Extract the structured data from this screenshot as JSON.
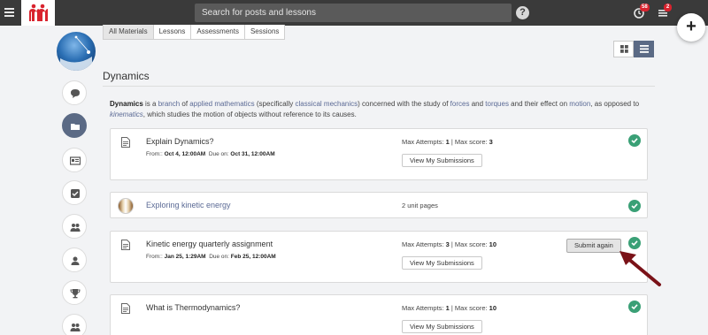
{
  "topbar": {
    "search_placeholder": "Search for posts and lessons",
    "help_label": "?",
    "notification_count": "58",
    "message_count": "2",
    "add_label": "+"
  },
  "tabs": [
    {
      "label": "All Materials",
      "active": true
    },
    {
      "label": "Lessons"
    },
    {
      "label": "Assessments"
    },
    {
      "label": "Sessions"
    }
  ],
  "page_title": "Dynamics",
  "description": {
    "term": "Dynamics",
    "t1": " is a ",
    "l1": "branch",
    "t2": " of ",
    "l2": "applied mathematics",
    "t3": " (specifically ",
    "l3": "classical mechanics",
    "t4": ") concerned with the study of ",
    "l4": "forces",
    "t5": " and ",
    "l5": "torques",
    "t6": " and their effect on ",
    "l6": "motion",
    "t7": ", as opposed to ",
    "l7": "kinematics",
    "t8": ", which studies the motion of objects without reference to its causes."
  },
  "labels": {
    "from": "From:: ",
    "due": "Due on: ",
    "max_attempts": "Max Attempts: ",
    "max_score": "Max score: ",
    "sep": " | ",
    "view_submissions": "View My Submissions",
    "submit_again": "Submit again"
  },
  "items": [
    {
      "title": "Explain Dynamics?",
      "from": "Oct 4, 12:00AM",
      "due": "Oct 31, 12:00AM",
      "attempts": "1",
      "score": "3"
    },
    {
      "title": "Exploring kinetic energy",
      "pages": "2 unit pages"
    },
    {
      "title": "Kinetic energy quarterly assignment",
      "from": "Jan 25, 1:29AM",
      "due": "Feb 25, 12:00AM",
      "attempts": "3",
      "score": "10"
    },
    {
      "title": "What is Thermodynamics?",
      "attempts": "1",
      "score": "10"
    }
  ],
  "colors": {
    "accent": "#5b6a85",
    "success": "#3aa076",
    "badge": "#d9232e",
    "arrow": "#7a1218"
  }
}
